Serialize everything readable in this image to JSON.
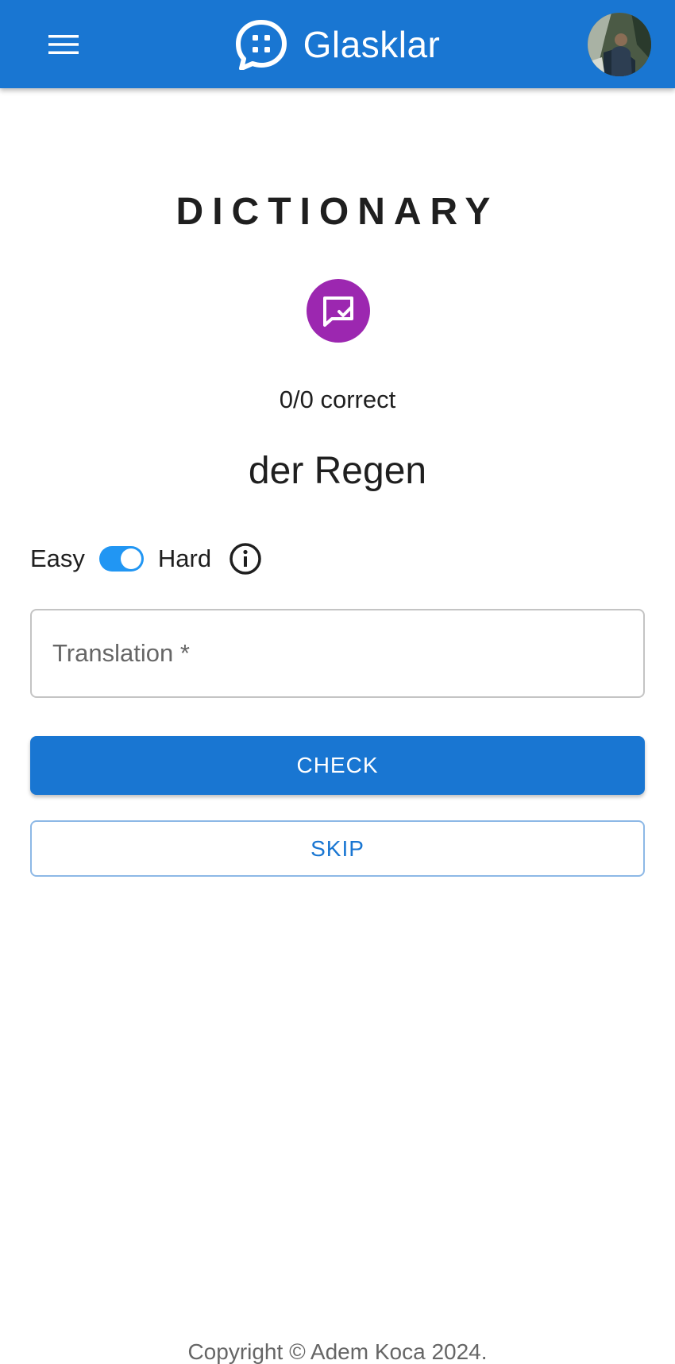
{
  "appbar": {
    "brand_name": "Glasklar",
    "menu_icon": "menu-icon",
    "logo_icon": "chat-bubble-dots-icon",
    "avatar_alt": "user-avatar",
    "color": "#1976d2"
  },
  "main": {
    "title": "DICTIONARY",
    "badge_icon": "chat-check-icon",
    "badge_color": "#9c27b0",
    "score_text": "0/0 correct",
    "word": "der Regen",
    "difficulty": {
      "easy_label": "Easy",
      "hard_label": "Hard",
      "mode": "Hard",
      "toggle_on": true,
      "info_icon": "info-icon"
    },
    "translation_placeholder": "Translation *",
    "translation_value": "",
    "check_label": "CHECK",
    "skip_label": "SKIP"
  },
  "footer": {
    "copyright": "Copyright © Adem Koca 2024."
  }
}
